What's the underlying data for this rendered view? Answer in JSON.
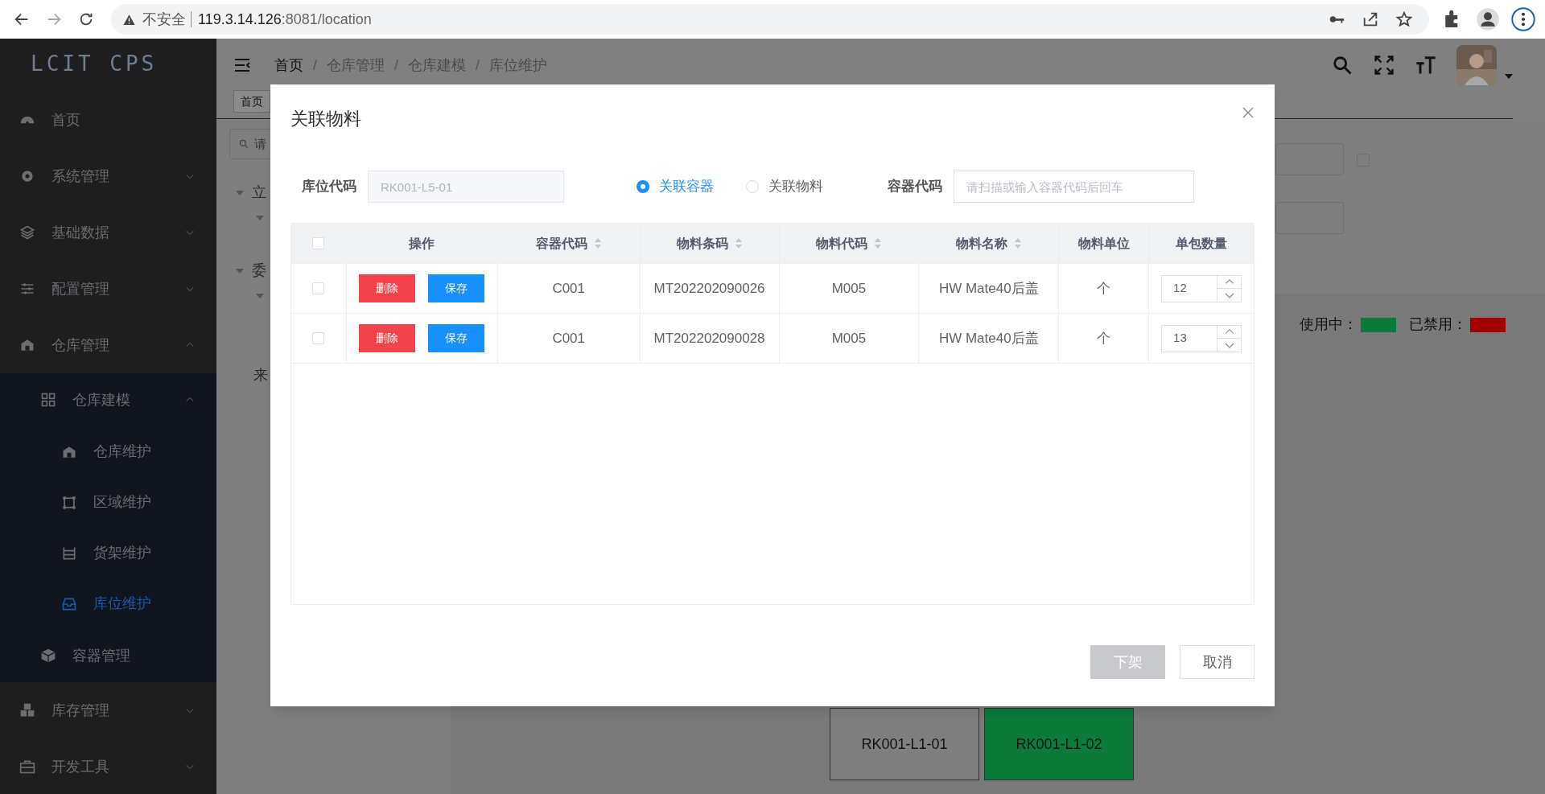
{
  "browser": {
    "security_label": "不安全",
    "url_host": "119.3.14.126",
    "url_path": ":8081/location"
  },
  "sidebar": {
    "logo": "LCIT CPS",
    "items": [
      {
        "label": "首页",
        "selected": false
      },
      {
        "label": "系统管理",
        "expanded": false,
        "selected": false
      },
      {
        "label": "基础数据",
        "expanded": false,
        "selected": false
      },
      {
        "label": "配置管理",
        "expanded": false,
        "selected": false
      },
      {
        "label": "仓库管理",
        "expanded": true,
        "selected": false,
        "children": [
          {
            "label": "仓库建模",
            "expanded": true,
            "selected": false,
            "children": [
              {
                "label": "仓库维护",
                "selected": false
              },
              {
                "label": "区域维护",
                "selected": false
              },
              {
                "label": "货架维护",
                "selected": false
              },
              {
                "label": "库位维护",
                "selected": true
              }
            ]
          },
          {
            "label": "容器管理",
            "selected": false
          }
        ]
      },
      {
        "label": "库存管理",
        "expanded": false,
        "selected": false
      },
      {
        "label": "开发工具",
        "expanded": false,
        "selected": false
      }
    ]
  },
  "header": {
    "breadcrumb": [
      {
        "label": "首页"
      },
      {
        "separator": "/",
        "label": "仓库管理"
      },
      {
        "separator": "/",
        "label": "仓库建模"
      },
      {
        "separator": "/",
        "label": "库位维护"
      }
    ]
  },
  "background": {
    "tab": "首页",
    "search_placeholder": "请",
    "tree": [
      "立",
      "委",
      "来"
    ],
    "filter_checkbox": {
      "checked": false
    },
    "legend": [
      {
        "label": "使用中：",
        "color": "#0b7a3b"
      },
      {
        "label": "已禁用：",
        "color": "#a30000"
      }
    ],
    "locations": [
      {
        "code": "RK001-L1-01",
        "color": "#7f7f7f"
      },
      {
        "code": "RK001-L1-02",
        "color": "#0b7a3b"
      }
    ]
  },
  "modal": {
    "title": "关联物料",
    "location_code": {
      "label": "库位代码",
      "value": "RK001-L5-01",
      "disabled": true
    },
    "radios": [
      {
        "label": "关联容器",
        "selected": true
      },
      {
        "label": "关联物料",
        "selected": false
      }
    ],
    "container_code": {
      "label": "容器代码",
      "placeholder": "请扫描或输入容器代码后回车"
    },
    "table": {
      "columns": [
        {
          "kind": "checkbox",
          "checked": false
        },
        {
          "kind": "text",
          "label": "操作",
          "sortable": false
        },
        {
          "kind": "text",
          "label": "容器代码",
          "sortable": true
        },
        {
          "kind": "text",
          "label": "物料条码",
          "sortable": true
        },
        {
          "kind": "text",
          "label": "物料代码",
          "sortable": true
        },
        {
          "kind": "text",
          "label": "物料名称",
          "sortable": true
        },
        {
          "kind": "text",
          "label": "物料单位",
          "sortable": false
        },
        {
          "kind": "text",
          "label": "单包数量",
          "sortable": false
        }
      ],
      "rows": [
        {
          "cells": [
            {
              "kind": "checkbox",
              "checked": false
            },
            {
              "kind": "actions",
              "buttons": [
                "删除",
                "保存"
              ]
            },
            {
              "kind": "text",
              "text": "C001"
            },
            {
              "kind": "text",
              "text": "MT202202090026"
            },
            {
              "kind": "text",
              "text": "M005"
            },
            {
              "kind": "text",
              "text": "HW Mate40后盖"
            },
            {
              "kind": "text",
              "text": "个"
            },
            {
              "kind": "number",
              "value": "12"
            }
          ]
        },
        {
          "cells": [
            {
              "kind": "checkbox",
              "checked": false
            },
            {
              "kind": "actions",
              "buttons": [
                "删除",
                "保存"
              ]
            },
            {
              "kind": "text",
              "text": "C001"
            },
            {
              "kind": "text",
              "text": "MT202202090028"
            },
            {
              "kind": "text",
              "text": "M005"
            },
            {
              "kind": "text",
              "text": "HW Mate40后盖"
            },
            {
              "kind": "text",
              "text": "个"
            },
            {
              "kind": "number",
              "value": "13"
            }
          ]
        }
      ]
    },
    "buttons": [
      {
        "label": "下架",
        "kind": "primary",
        "disabled": true
      },
      {
        "label": "取消",
        "kind": "default",
        "disabled": false
      }
    ]
  }
}
